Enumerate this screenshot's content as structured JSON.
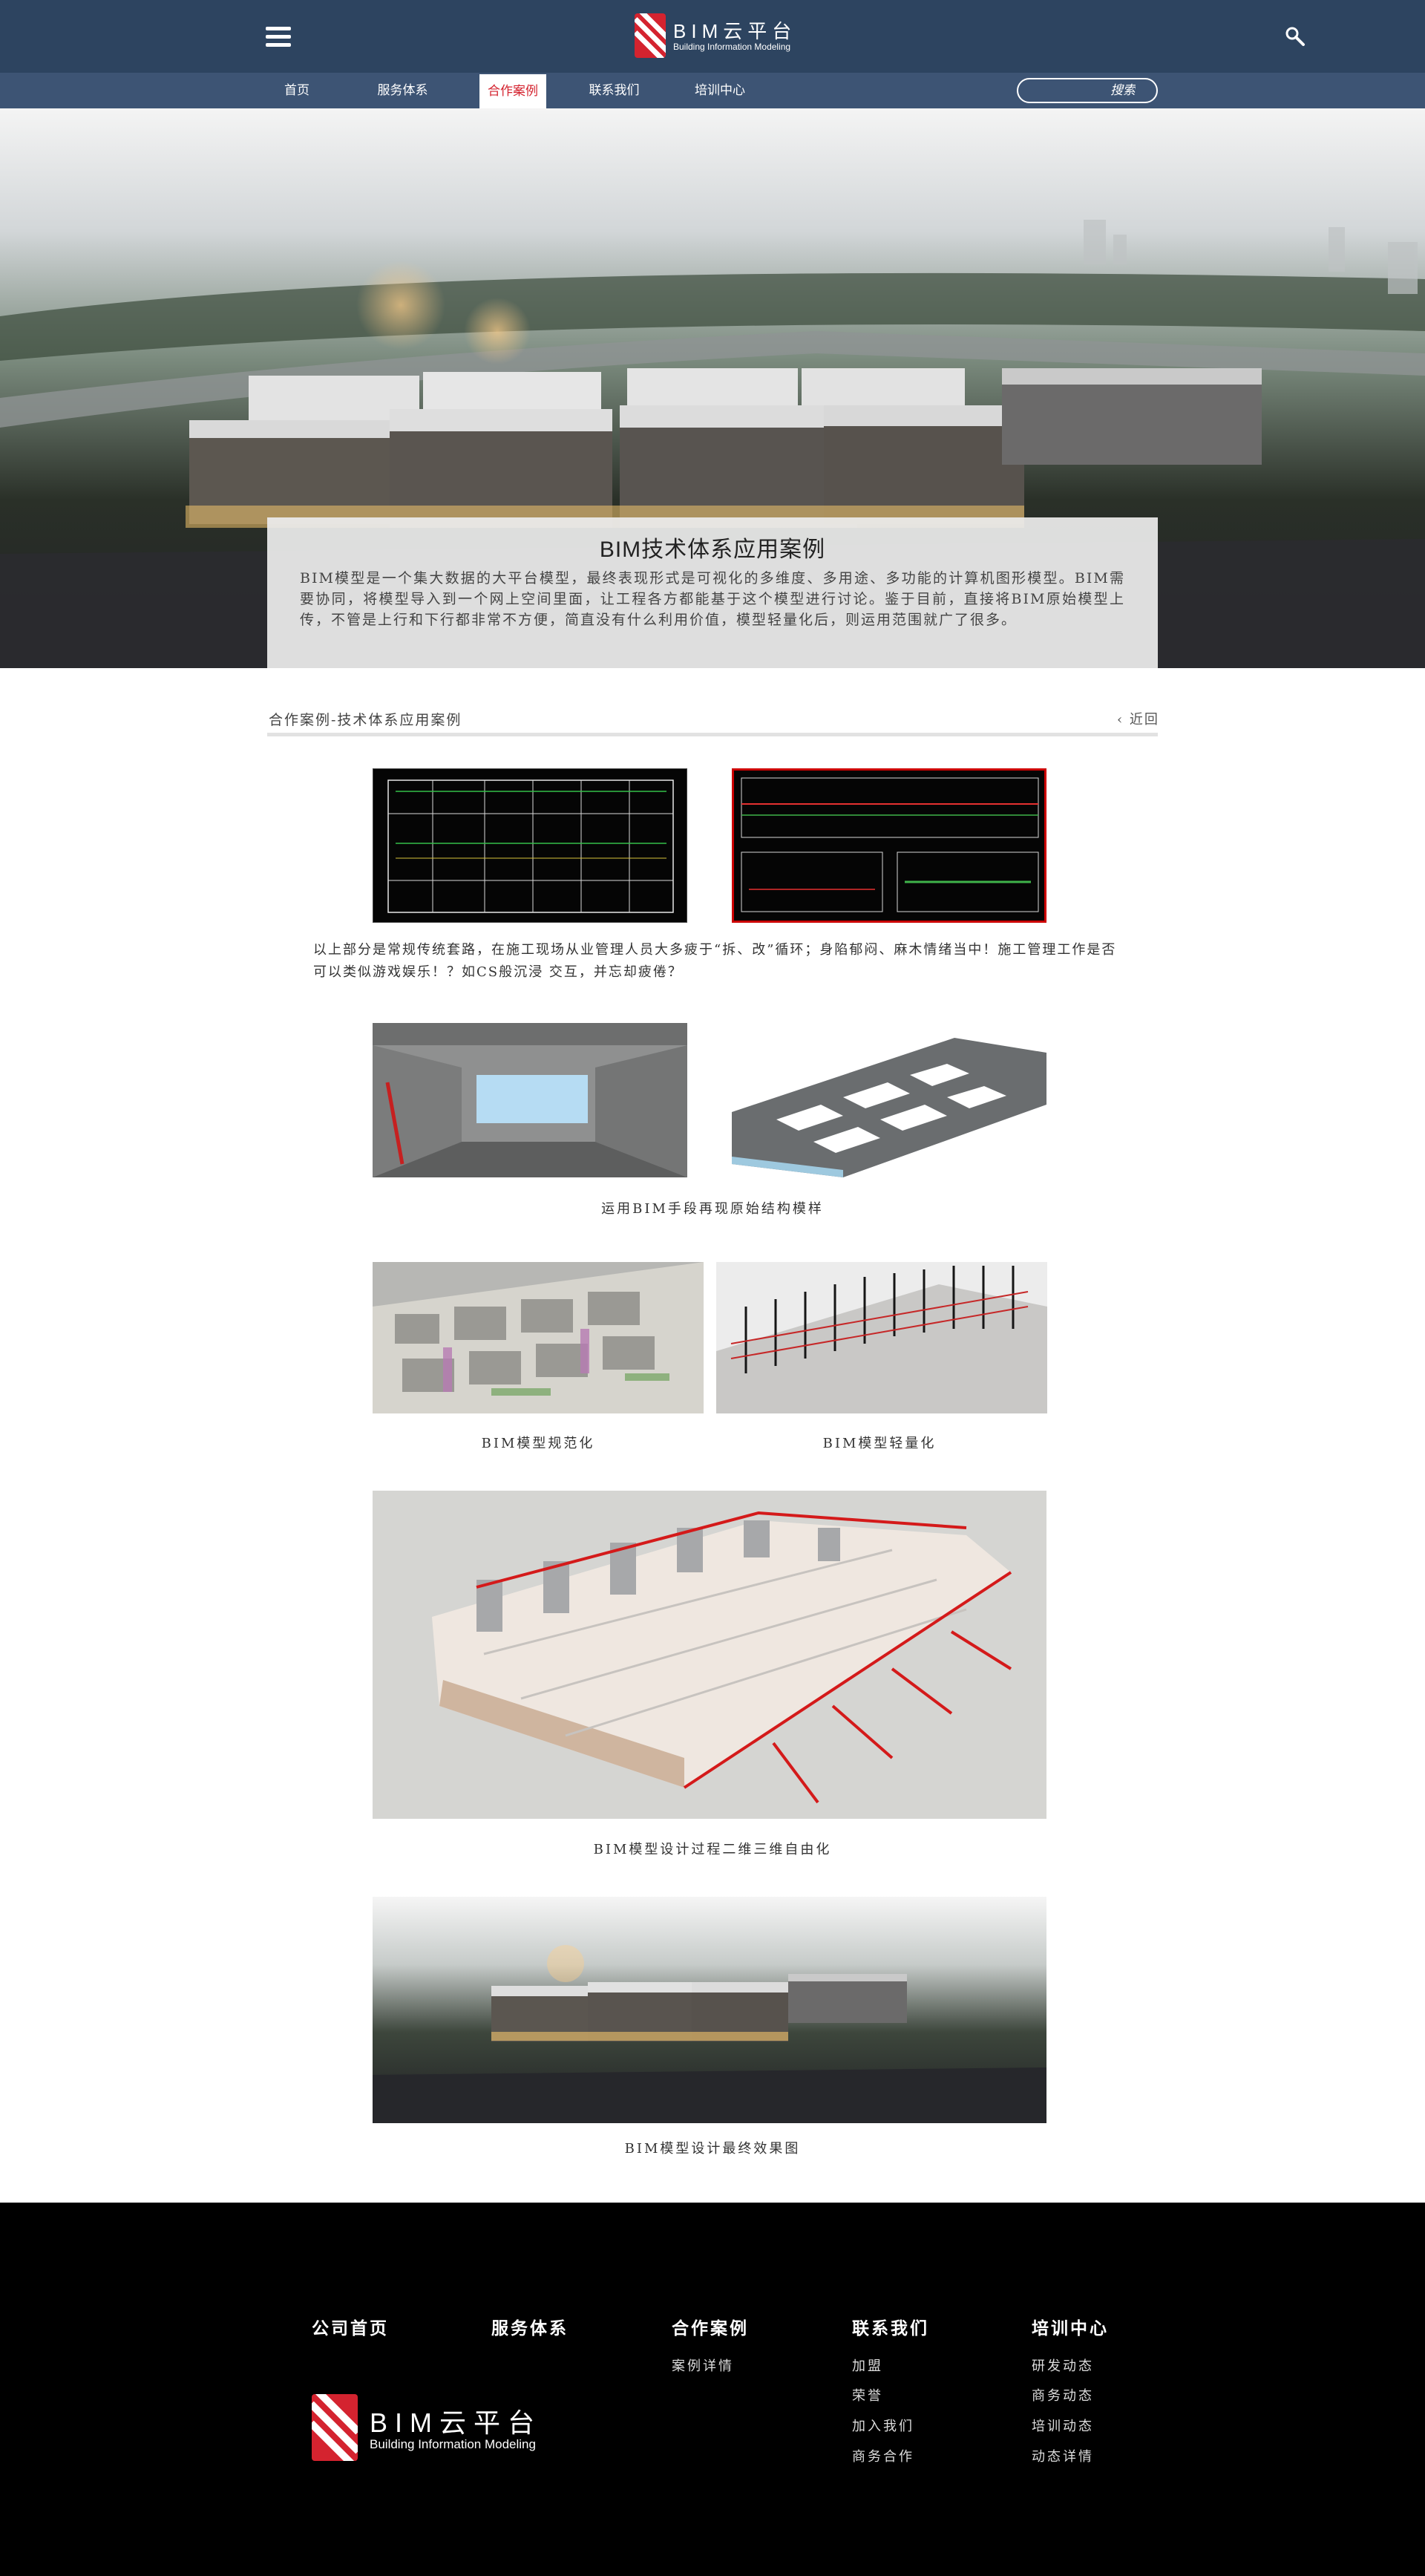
{
  "header": {
    "logo_title": "BIM云平台",
    "logo_subtitle": "Building Information Modeling",
    "icons": {
      "menu": "hamburger-menu-icon",
      "search": "search-icon"
    }
  },
  "nav": {
    "items": [
      {
        "label": "首页",
        "active": false
      },
      {
        "label": "服务体系",
        "active": false
      },
      {
        "label": "合作案例",
        "active": true
      },
      {
        "label": "联系我们",
        "active": false
      },
      {
        "label": "培训中心",
        "active": false
      }
    ],
    "search_placeholder": "搜索"
  },
  "hero": {
    "title": "BIM技术体系应用案例",
    "description": "BIM模型是一个集大数据的大平台模型，最终表现形式是可视化的多维度、多用途、多功能的计算机图形模型。BIM需要协同，将模型导入到一个网上空间里面，让工程各方都能基于这个模型进行讨论。鉴于目前，直接将BIM原始模型上传，不管是上行和下行都非常不方便，简直没有什么利用价值，模型轻量化后，则运用范围就广了很多。"
  },
  "breadcrumb": {
    "text": "合作案例-技术体系应用案例",
    "back_label": "近回"
  },
  "content": {
    "paragraph_1": "以上部分是常规传统套路，在施工现场从业管理人员大多疲于“拆、改”循环；身陷郁闷、麻木情绪当中！施工管理工作是否可以类似游戏娱乐！？如CS般沉浸 交互，并忘却疲倦？",
    "caption_structure": "运用BIM手段再现原始结构模样",
    "caption_standard": "BIM模型规范化",
    "caption_light": "BIM模型轻量化",
    "caption_free": "BIM模型设计过程二维三维自由化",
    "caption_final": "BIM模型设计最终效果图"
  },
  "footer": {
    "columns": [
      {
        "title": "公司首页",
        "links": []
      },
      {
        "title": "服务体系",
        "links": []
      },
      {
        "title": "合作案例",
        "links": [
          "案例详情"
        ]
      },
      {
        "title": "联系我们",
        "links": [
          "加盟",
          "荣誉",
          "加入我们",
          "商务合作"
        ]
      },
      {
        "title": "培训中心",
        "links": [
          "研发动态",
          "商务动态",
          "培训动态",
          "动态详情"
        ]
      }
    ],
    "logo_title": "BIM云平台",
    "logo_subtitle": "Building Information Modeling"
  },
  "colors": {
    "header_bg": "#2d4460",
    "nav_bg": "#3d5474",
    "accent_red": "#d4232f",
    "footer_bg": "#000000"
  }
}
